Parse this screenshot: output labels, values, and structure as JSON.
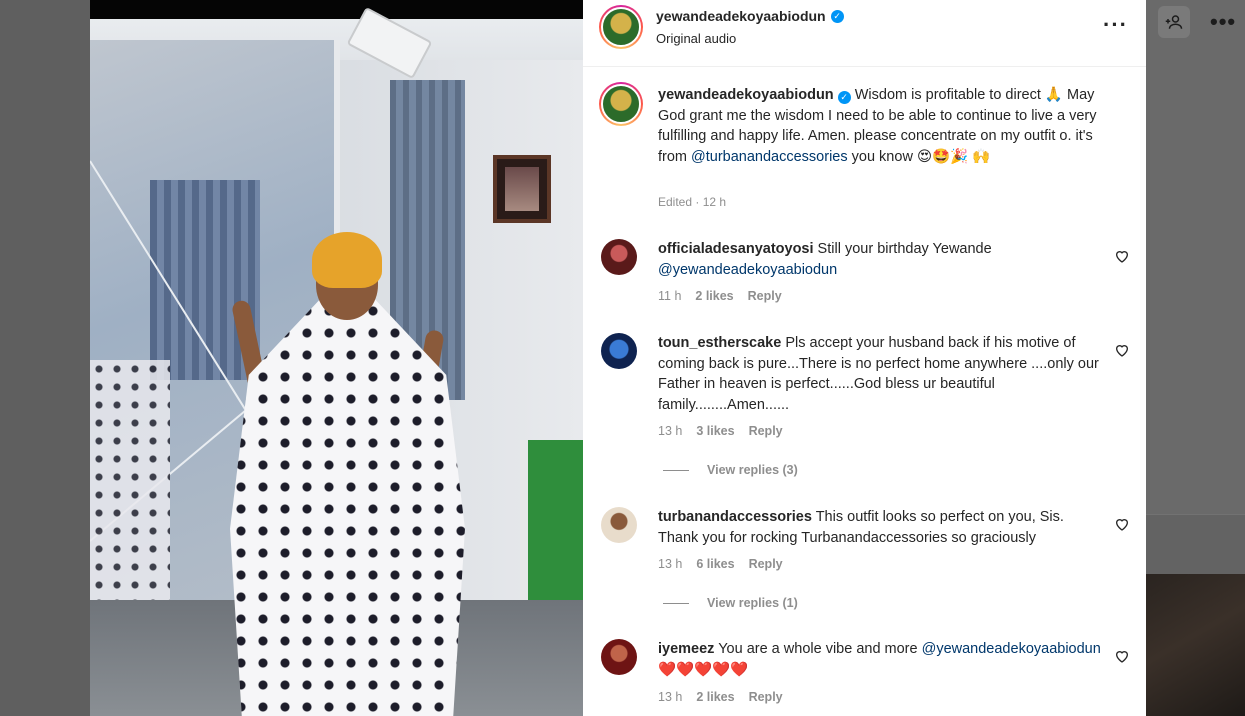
{
  "post": {
    "username": "yewandeadekoyaabiodun",
    "audio": "Original audio",
    "more_icon": "more-horizontal-icon"
  },
  "caption": {
    "username": "yewandeadekoyaabiodun",
    "text_before": " Wisdom is profitable to direct 🙏 May God grant me the wisdom I need to be able to continue to live a very fulfilling and happy life. Amen. please concentrate on my outfit o. it's from ",
    "mention": "@turbanandaccessories",
    "text_after": " you know 😍🤩🎉 🙌",
    "meta": "Edited · 12 h"
  },
  "comments": [
    {
      "username": "officialadesanyatoyosi",
      "text": " Still your birthday Yewande ",
      "mention": "@yewandeadekoyaabiodun",
      "tail": "",
      "time": "11 h",
      "likes": "2 likes",
      "reply": "Reply",
      "avatar_color": "#7a2a2a"
    },
    {
      "username": "toun_estherscake",
      "text": " Pls accept your husband back if his motive of coming back is pure...There is no perfect home anywhere ....only our Father in heaven is perfect......God bless ur beautiful family........Amen......",
      "mention": "",
      "tail": "",
      "time": "13 h",
      "likes": "3 likes",
      "reply": "Reply",
      "view_replies": "View replies (3)",
      "avatar_color": "#1e3a8a"
    },
    {
      "username": "turbanandaccessories",
      "text": " This outfit looks so perfect on you, Sis. Thank you for rocking Turbanandaccessories so graciously",
      "mention": "",
      "tail": "",
      "time": "13 h",
      "likes": "6 likes",
      "reply": "Reply",
      "view_replies": "View replies (1)",
      "avatar_color": "#c9b9a8"
    },
    {
      "username": "iyemeez",
      "text": " You are a whole vibe and more ",
      "mention": "@yewandeadekoyaabiodun",
      "tail": " ❤️❤️❤️❤️❤️",
      "time": "13 h",
      "likes": "2 likes",
      "reply": "Reply",
      "avatar_color": "#8b1e1e"
    }
  ],
  "colors": {
    "verified": "#0095f6",
    "mention": "#00376b",
    "meta_gray": "#8e8e8e"
  }
}
